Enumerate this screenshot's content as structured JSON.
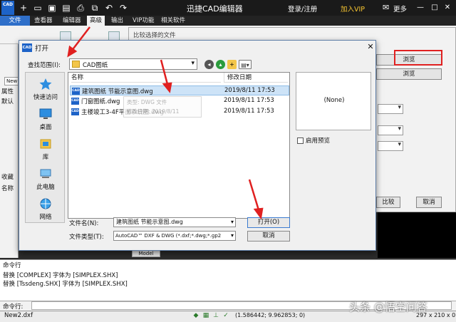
{
  "app": {
    "logo_text": "CAD",
    "title": "迅捷CAD编辑器",
    "login_label": "登录/注册",
    "vip_label": "加入VIP",
    "more_label": "更多"
  },
  "menu": {
    "items": [
      "文件",
      "查看器",
      "编辑器",
      "高级",
      "输出",
      "VIP功能",
      "相关软件"
    ]
  },
  "background": {
    "compare_dialog_title": "比较选择的文件",
    "browse_label": "浏览",
    "compare_label": "比较",
    "cancel_label": "取消",
    "left_panel": {
      "tab_new": "New",
      "properties": "属性",
      "default": "默认",
      "favorites": "收藏",
      "name": "名称"
    },
    "model_tab": "Model"
  },
  "dialog": {
    "title": "打开",
    "icon_text": "CAD",
    "look_in_label": "查找范围(I):",
    "look_in_value": "CAD图纸",
    "places": [
      {
        "label": "快速访问",
        "icon": "star-icon"
      },
      {
        "label": "桌面",
        "icon": "desktop-icon"
      },
      {
        "label": "库",
        "icon": "library-icon"
      },
      {
        "label": "此电脑",
        "icon": "computer-icon"
      },
      {
        "label": "网络",
        "icon": "network-icon"
      }
    ],
    "columns": {
      "name": "名称",
      "date": "修改日期"
    },
    "files": [
      {
        "name": "建筑图纸 节能示意图.dwg",
        "date": "2019/8/11 17:53",
        "selected": true
      },
      {
        "name": "门窗图纸.dwg",
        "date": "2019/8/11 17:53",
        "selected": false
      },
      {
        "name": "主楼竣工3-4F平面系统图.dwg",
        "date": "2019/8/11 17:53",
        "selected": false
      }
    ],
    "tooltip": {
      "type": "类型: DWG 文件",
      "date": "修改日期: 2019/8/11"
    },
    "preview_text": "(None)",
    "preview_checkbox_label": "启用预览",
    "file_name_label": "文件名(N):",
    "file_name_value": "建筑图纸 节能示意图.dwg",
    "file_type_label": "文件类型(T):",
    "file_type_value": "AutoCAD™ DXF & DWG (*.dxf;*.dwg;*.gp2",
    "open_label": "打开(O)",
    "cancel_label": "取消"
  },
  "command": {
    "panel_title": "命令行",
    "lines": [
      "替换 [COMPLEX] 字体为 [SIMPLEX.SHX]",
      "替换 [Tssdeng.SHX] 字体为 [SIMPLEX.SHX]"
    ],
    "input_label": "命令行:"
  },
  "status": {
    "file": "New2.dxf",
    "coords": "(1.586442; 9.962853; 0)",
    "paper": "297 x 210 x 0"
  },
  "watermark": "头条 @悟空问答",
  "colors": {
    "accent": "#2f6fc9",
    "highlight_red": "#e02020",
    "selection": "#cde3f7"
  }
}
